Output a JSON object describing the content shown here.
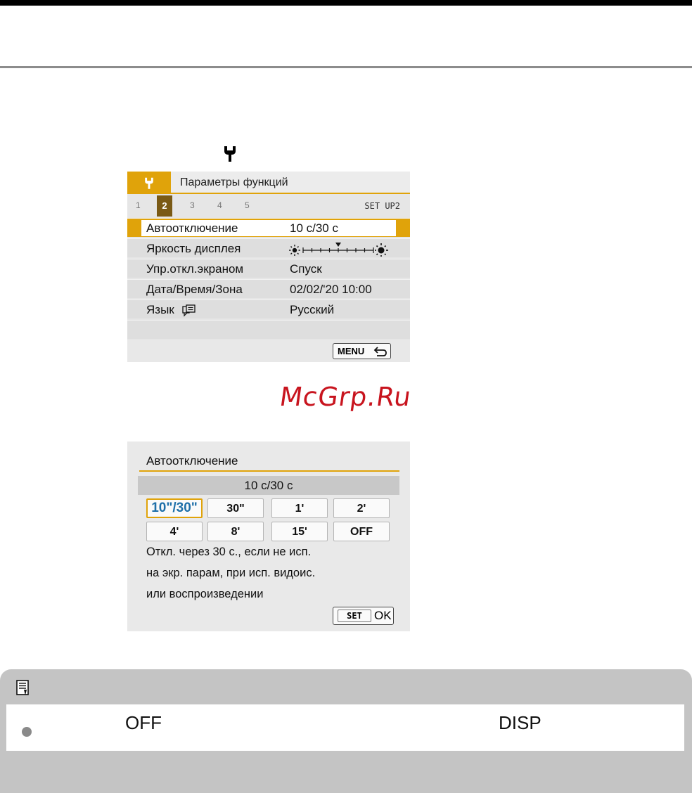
{
  "screen1": {
    "tab_icon": "wrench-icon",
    "title": "Параметры функций",
    "pages": [
      "1",
      "2",
      "3",
      "4",
      "5"
    ],
    "active_page": "2",
    "setup_label": "SET UP2",
    "rows": [
      {
        "label": "Автоотключение",
        "value": "10 с/30 с"
      },
      {
        "label": "Яркость дисплея",
        "value": ""
      },
      {
        "label": "Упр.откл.экраном",
        "value": "Спуск"
      },
      {
        "label": "Дата/Время/Зона",
        "value": "02/02/'20 10:00"
      },
      {
        "label": "Язык",
        "value": "Русский"
      }
    ],
    "brightness_level": 0.5,
    "menu_button": "MENU"
  },
  "watermark": "McGrp.Ru",
  "screen2": {
    "title": "Автоотключение",
    "current": "10 с/30 с",
    "options": [
      "10\"/30\"",
      "30\"",
      "1'",
      "2'",
      "4'",
      "8'",
      "15'",
      "OFF"
    ],
    "selected_index": 0,
    "description": [
      "Откл. через 30 с., если не исп.",
      "на экр. парам, при исп. видоис.",
      "или воспроизведении"
    ],
    "set_label": "SET",
    "ok_label": "OK"
  },
  "note": {
    "icon": "memo-icon",
    "off_text": "OFF",
    "disp_text": "DISP"
  },
  "colors": {
    "accent": "#e0a30a",
    "selected_text": "#1e6fa8",
    "watermark": "#c8141e"
  }
}
